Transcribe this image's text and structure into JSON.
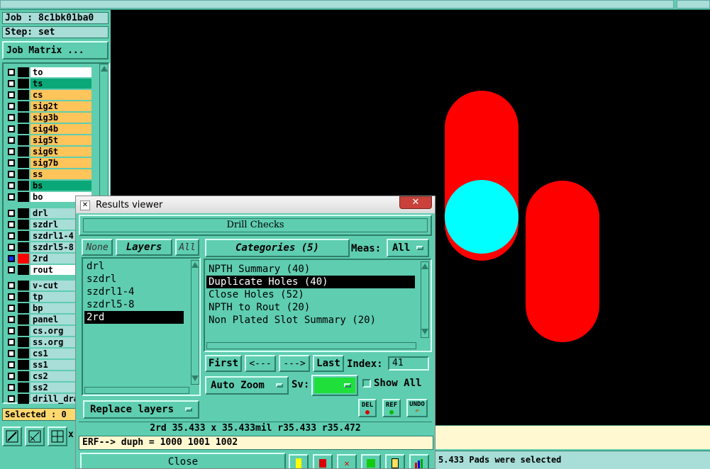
{
  "app": {
    "job_label": "Job : 8c1bk01ba0",
    "step_label": "Step: set",
    "job_matrix_button": "Job Matrix ...",
    "selected_label": "Selected : 0",
    "status_text": "5.433 Pads were selected",
    "x_label": "x"
  },
  "layers_group1": [
    {
      "name": "to",
      "color": "#ffffff"
    },
    {
      "name": "ts",
      "color": "#0aa878"
    },
    {
      "name": "cs",
      "color": "#ffc45a"
    },
    {
      "name": "sig2t",
      "color": "#ffc45a"
    },
    {
      "name": "sig3b",
      "color": "#ffc45a"
    },
    {
      "name": "sig4b",
      "color": "#ffc45a"
    },
    {
      "name": "sig5t",
      "color": "#ffc45a"
    },
    {
      "name": "sig6t",
      "color": "#ffc45a"
    },
    {
      "name": "sig7b",
      "color": "#ffc45a"
    },
    {
      "name": "ss",
      "color": "#ffc45a"
    },
    {
      "name": "bs",
      "color": "#0aa878"
    },
    {
      "name": "bo",
      "color": "#ffffff"
    }
  ],
  "layers_group2": [
    {
      "name": "drl",
      "color": "#a8ddd8"
    },
    {
      "name": "szdrl",
      "color": "#a8ddd8"
    },
    {
      "name": "szdrl1-4",
      "color": "#a8ddd8"
    },
    {
      "name": "szdrl5-8",
      "color": "#a8ddd8"
    },
    {
      "name": "2rd",
      "color": "#a8ddd8",
      "active": true
    },
    {
      "name": "rout",
      "color": "#ffffff"
    }
  ],
  "layers_group3": [
    {
      "name": "v-cut",
      "color": "#a8ddd8"
    },
    {
      "name": "tp",
      "color": "#a8ddd8"
    },
    {
      "name": "bp",
      "color": "#a8ddd8"
    },
    {
      "name": "panel",
      "color": "#a8ddd8"
    },
    {
      "name": "cs.org",
      "color": "#a8ddd8"
    },
    {
      "name": "ss.org",
      "color": "#a8ddd8"
    },
    {
      "name": "cs1",
      "color": "#a8ddd8"
    },
    {
      "name": "ss1",
      "color": "#a8ddd8"
    },
    {
      "name": "cs2",
      "color": "#a8ddd8"
    },
    {
      "name": "ss2",
      "color": "#a8ddd8"
    },
    {
      "name": "drill_dra",
      "color": "#a8ddd8"
    }
  ],
  "dialog": {
    "title": "Results viewer",
    "header": "Drill Checks",
    "none_button": "None",
    "layers_button": "Layers",
    "all_button": "All",
    "categories_button": "Categories (5)",
    "meas_label": "Meas:",
    "meas_value": "All",
    "layer_list": [
      "drl",
      "szdrl",
      "szdrl1-4",
      "szdrl5-8",
      "2rd"
    ],
    "selected_layer": "2rd",
    "categories": [
      "NPTH Summary (40)",
      "Duplicate Holes (40)",
      "Close Holes (52)",
      "NPTH to Rout (20)",
      "Non Plated Slot Summary (20)"
    ],
    "selected_category": "Duplicate Holes (40)",
    "first_button": "First",
    "prev_button": "<---",
    "next_button": "--->",
    "last_button": "Last",
    "index_label": "Index:",
    "index_value": "41",
    "auto_zoom_label": "Auto Zoom",
    "sv_label": "Sv:",
    "show_all_label": "Show All",
    "replace_layers_label": "Replace layers",
    "del_label": "DEL",
    "ref_label": "REF",
    "undo_label": "UNDO",
    "measurement_text": "2rd 35.433 x 35.433mil  r35.433  r35.472",
    "command_text": "ERF--> duph = 1000 1001 1002",
    "close_button": "Close",
    "sv_color": "#1fe03a"
  },
  "canvas": {
    "background": "#000000",
    "slot_color": "#ff0000",
    "hole_color": "#00ffff"
  }
}
